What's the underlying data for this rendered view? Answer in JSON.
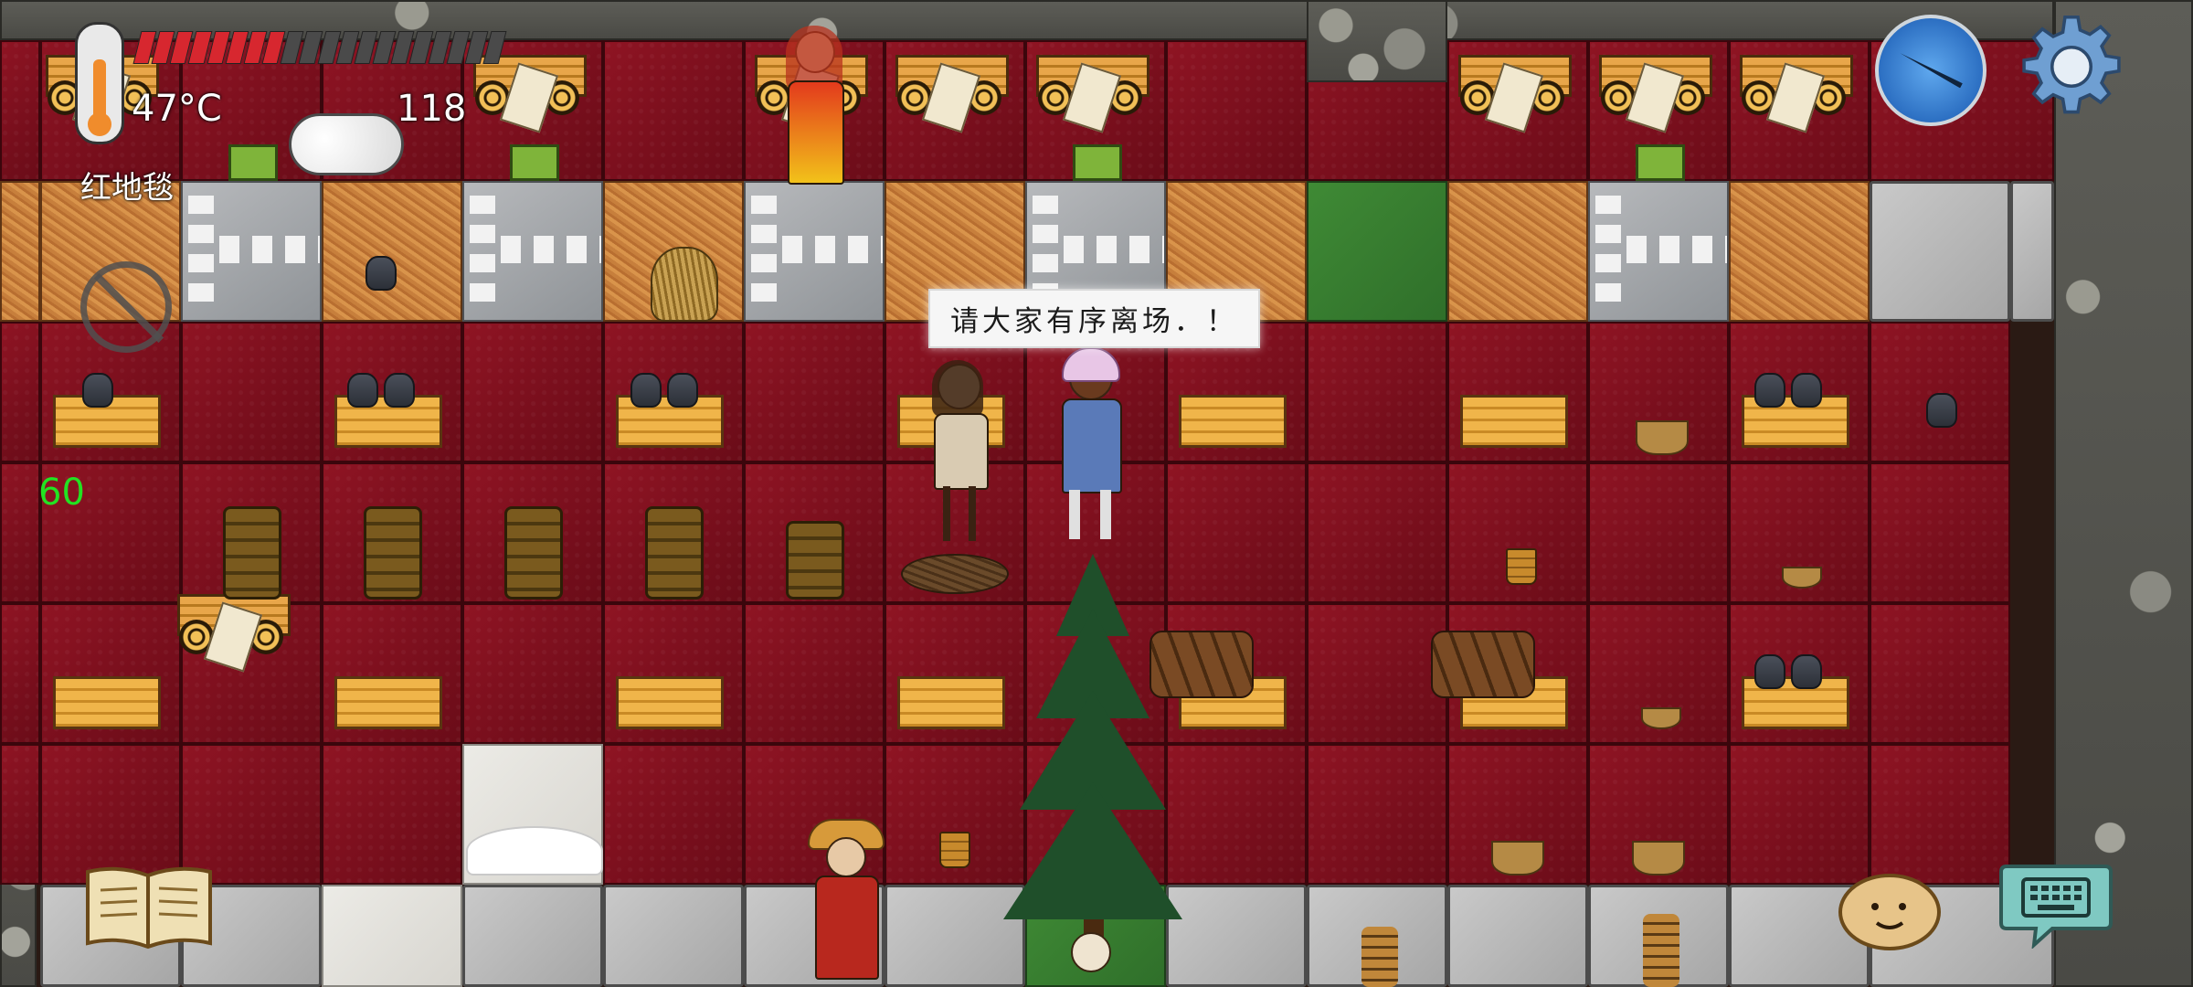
{
  "hud": {
    "temperature": "47°C",
    "food_pips_total": 20,
    "food_pips_filled": 8,
    "age": "118",
    "tile_label": "红地毯",
    "fps": "60"
  },
  "speech": {
    "text": "请大家有序离场．！"
  },
  "icons": {
    "thermometer": "thermometer-icon",
    "compass": "compass-icon",
    "settings": "gear-icon",
    "no_entry": "no-entry-icon",
    "book": "book-icon",
    "emote": "emote-face-icon",
    "keyboard": "keyboard-icon"
  },
  "colors": {
    "carpet": "#8f1423",
    "straw": "#c77f3c",
    "food_on": "#d7272f",
    "food_off": "#4a4a4a",
    "fps_text": "#22e322",
    "compass": "#2c6fc2"
  }
}
